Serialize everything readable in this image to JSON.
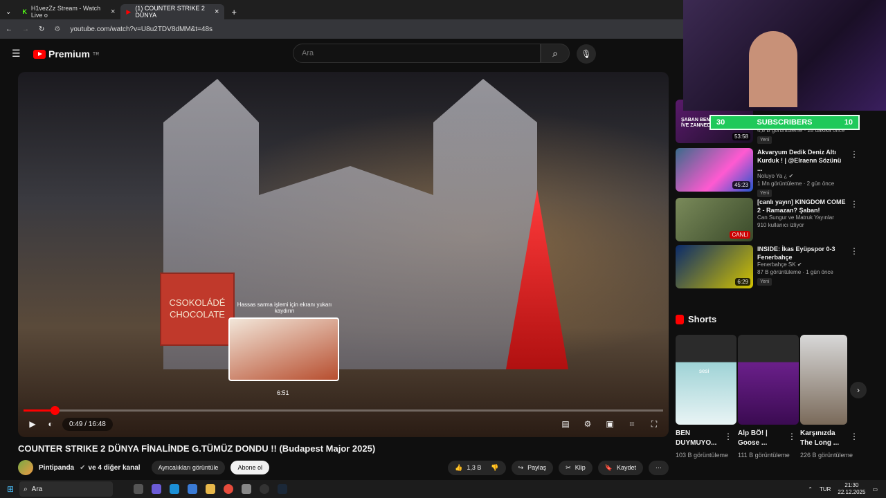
{
  "browser": {
    "tabs": [
      {
        "label": "H1vezZz Stream - Watch Live o"
      },
      {
        "label": "(1) COUNTER STRIKE 2 DÜNYA"
      }
    ],
    "url": "youtube.com/watch?v=U8u2TDV8dMM&t=48s"
  },
  "header": {
    "logo_text": "Premium",
    "logo_sup": "TR",
    "search_placeholder": "Ara"
  },
  "player": {
    "sign_text": "CSOKOLÁDÉ CHOCOLATE",
    "seek_hint": "Hassas sarma işlemi için ekranı yukarı kaydırın",
    "preview_time": "6:51",
    "time": "0:49 / 16:48",
    "progress": 0.049
  },
  "video": {
    "title": "COUNTER STRIKE 2 DÜNYA FİNALİNDE G.TÜMÜZ DONDU !! (Budapest Major 2025)",
    "channel": "Pintipanda",
    "channel_extra": "ve 4 diğer kanal",
    "perks_label": "Ayrıcalıkları görüntüle",
    "subscribe_label": "Abone ol",
    "likes": "1,3 B",
    "share_label": "Paylaş",
    "clip_label": "Klip",
    "save_label": "Kaydet"
  },
  "overlay": {
    "subs_left": "30",
    "subs_label": "SUBSCRIBERS",
    "subs_right": "10"
  },
  "related": [
    {
      "title": "",
      "meta": "4,8 B görüntüleme · 28 dakika önce",
      "duration": "53:58",
      "badge": "Yeni",
      "thumb_text": "ŞABAN BENİ RECEP İVE ZANNEDİYORL..."
    },
    {
      "title": "Akvaryum Dedik Deniz Altı Kurduk ! | @Elraenn Sözünü ...",
      "channel": "Noluyo Ya ¿",
      "meta": "1 Mn görüntüleme · 2 gün önce",
      "duration": "45:23",
      "badge": "Yeni"
    },
    {
      "title": "[canlı yayın] KINGDOM COME 2 - Ramazan? Şaban!",
      "channel": "Can Sungur ve Matruk Yayınlar",
      "meta": "910 kullanıcı izliyor",
      "duration": "CANLI",
      "badge": ""
    },
    {
      "title": "INSIDE: İkas Eyüpspor 0-3 Fenerbahçe",
      "channel": "Fenerbahçe SK",
      "meta": "87 B görüntüleme · 1 gün önce",
      "duration": "6:29",
      "badge": "Yeni"
    }
  ],
  "shorts": {
    "heading": "Shorts",
    "items": [
      {
        "title": "BEN DUYMUYO...",
        "views": "103 B görüntüleme",
        "overlay": "sesi"
      },
      {
        "title": "Alp BÖ! | Goose ...",
        "views": "111 B görüntüleme"
      },
      {
        "title": "Karşınızda The Long ...",
        "views": "226 B görüntüleme"
      }
    ]
  },
  "taskbar": {
    "search_label": "Ara",
    "lang": "TUR",
    "time": "21:30",
    "date": "22.12.2025"
  }
}
